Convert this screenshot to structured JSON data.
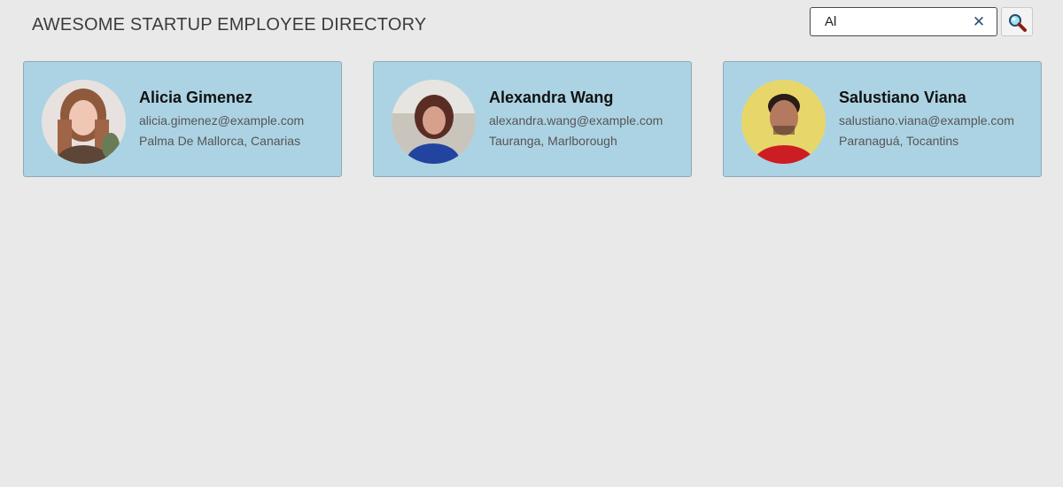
{
  "header": {
    "title": "AWESOME STARTUP EMPLOYEE DIRECTORY"
  },
  "search": {
    "value": "Al",
    "clear_icon": "close-icon",
    "button_icon": "magnifier-icon"
  },
  "employees": [
    {
      "name": "Alicia Gimenez",
      "email": "alicia.gimenez@example.com",
      "location": "Palma De Mallorca, Canarias"
    },
    {
      "name": "Alexandra Wang",
      "email": "alexandra.wang@example.com",
      "location": "Tauranga, Marlborough"
    },
    {
      "name": "Salustiano Viana",
      "email": "salustiano.viana@example.com",
      "location": "Paranaguá, Tocantins"
    }
  ],
  "colors": {
    "background": "#e9e9e9",
    "card": "#acd3e3",
    "card_border": "#8fa9b5",
    "title": "#3c3c3c"
  }
}
